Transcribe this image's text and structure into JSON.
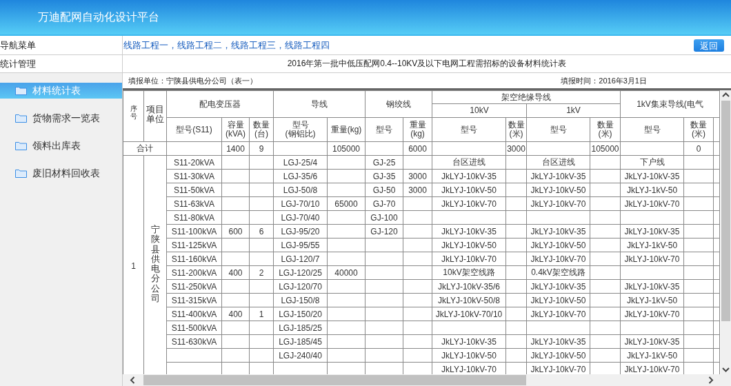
{
  "header": {
    "title": "万迪配网自动化设计平台"
  },
  "nav_bar": {
    "label": "导航菜单",
    "links": [
      "线路工程一",
      "线路工程二",
      "线路工程三",
      "线路工程四"
    ],
    "separator": "，",
    "back_button": "返回"
  },
  "section": {
    "label": "统计管理"
  },
  "sidebar": {
    "items": [
      {
        "label": "材料统计表",
        "selected": true
      },
      {
        "label": "货物需求一览表",
        "selected": false
      },
      {
        "label": "领料出库表",
        "selected": false
      },
      {
        "label": "废旧材料回收表",
        "selected": false
      }
    ]
  },
  "report": {
    "title": "2016年第一批中低压配网0.4--10KV及以下电网工程需招标的设备材料统计表",
    "unit": "填报单位：宁陕县供电分公司（表一）",
    "date": "填报时间：2016年3月1日"
  },
  "table": {
    "header_rows": [
      [
        {
          "label": "序号",
          "rowspan": 3,
          "kind": "stacked"
        },
        {
          "label": "项目单位",
          "rowspan": 3,
          "kind": "wrapped"
        },
        {
          "label": "配电变压器",
          "colspan": 3,
          "rowspan": 2
        },
        {
          "label": "导线",
          "colspan": 2,
          "rowspan": 2
        },
        {
          "label": "钢绞线",
          "colspan": 2,
          "rowspan": 2
        },
        {
          "label": "架空绝缘导线",
          "colspan": 4
        },
        {
          "label": "1kV集束导线(电气",
          "colspan": 3,
          "rowspan": 2
        }
      ],
      [
        {
          "label": "10kV",
          "colspan": 2
        },
        {
          "label": "1kV",
          "colspan": 2
        }
      ],
      [
        {
          "label": "型号(S11)"
        },
        {
          "label": "容量\n(kVA)"
        },
        {
          "label": "数量\n(台)"
        },
        {
          "label": "型号\n(钢铝比)"
        },
        {
          "label": "重量(kg)"
        },
        {
          "label": "型号"
        },
        {
          "label": "重量\n(kg)"
        },
        {
          "label": "型号"
        },
        {
          "label": "数量\n(米)"
        },
        {
          "label": "型号"
        },
        {
          "label": "数量\n(米)"
        },
        {
          "label": "型号"
        },
        {
          "label": "数量\n(米)"
        },
        {
          "kind": "blank"
        }
      ]
    ],
    "total_row": {
      "label": "合计",
      "capacity": "1400",
      "quantity": "9",
      "conductor_weight": "105000",
      "strand_weight": "6000",
      "kv10_length": "3000",
      "kv1_length": "105000",
      "bundled_length": "0"
    },
    "group": {
      "index": "1",
      "unit": "宁陕县供电分公司"
    },
    "rows": [
      {
        "transformer_model": "S11-20kVA",
        "conductor_model": "LGJ-25/4",
        "strand_model": "GJ-25",
        "kv10_model": "台区进线",
        "kv1_model": "台区进线",
        "bundled_model": "下户线"
      },
      {
        "transformer_model": "S11-30kVA",
        "conductor_model": "LGJ-35/6",
        "strand_model": "GJ-35",
        "strand_weight": "3000",
        "kv10_model": "JkLYJ-10kV-35",
        "kv1_model": "JkLYJ-10kV-35",
        "bundled_model": "JkLYJ-10kV-35"
      },
      {
        "transformer_model": "S11-50kVA",
        "conductor_model": "LGJ-50/8",
        "strand_model": "GJ-50",
        "strand_weight": "3000",
        "kv10_model": "JkLYJ-10kV-50",
        "kv1_model": "JkLYJ-10kV-50",
        "bundled_model": "JkLYJ-1kV-50"
      },
      {
        "transformer_model": "S11-63kVA",
        "conductor_model": "LGJ-70/10",
        "conductor_weight": "65000",
        "strand_model": "GJ-70",
        "kv10_model": "JkLYJ-10kV-70",
        "kv1_model": "JkLYJ-10kV-70",
        "bundled_model": "JkLYJ-10kV-70"
      },
      {
        "transformer_model": "S11-80kVA",
        "conductor_model": "LGJ-70/40",
        "strand_model": "GJ-100"
      },
      {
        "transformer_model": "S11-100kVA",
        "capacity": "600",
        "quantity": "6",
        "conductor_model": "LGJ-95/20",
        "strand_model": "GJ-120",
        "kv10_model": "JkLYJ-10kV-35",
        "kv1_model": "JkLYJ-10kV-35",
        "bundled_model": "JkLYJ-10kV-35"
      },
      {
        "transformer_model": "S11-125kVA",
        "conductor_model": "LGJ-95/55",
        "kv10_model": "JkLYJ-10kV-50",
        "kv1_model": "JkLYJ-10kV-50",
        "bundled_model": "JkLYJ-1kV-50"
      },
      {
        "transformer_model": "S11-160kVA",
        "conductor_model": "LGJ-120/7",
        "kv10_model": "JkLYJ-10kV-70",
        "kv1_model": "JkLYJ-10kV-70",
        "bundled_model": "JkLYJ-10kV-70"
      },
      {
        "transformer_model": "S11-200kVA",
        "capacity": "400",
        "quantity": "2",
        "conductor_model": "LGJ-120/25",
        "conductor_weight": "40000",
        "kv10_model": "10kV架空线路",
        "kv1_model": "0.4kV架空线路"
      },
      {
        "transformer_model": "S11-250kVA",
        "conductor_model": "LGJ-120/70",
        "kv10_model": "JkLYJ-10kV-35/6",
        "kv1_model": "JkLYJ-10kV-35",
        "bundled_model": "JkLYJ-10kV-35"
      },
      {
        "transformer_model": "S11-315kVA",
        "conductor_model": "LGJ-150/8",
        "kv10_model": "JkLYJ-10kV-50/8",
        "kv1_model": "JkLYJ-10kV-50",
        "bundled_model": "JkLYJ-1kV-50"
      },
      {
        "transformer_model": "S11-400kVA",
        "capacity": "400",
        "quantity": "1",
        "conductor_model": "LGJ-150/20",
        "kv10_model": "JkLYJ-10kV-70/10",
        "kv1_model": "JkLYJ-10kV-70",
        "bundled_model": "JkLYJ-10kV-70"
      },
      {
        "transformer_model": "S11-500kVA",
        "conductor_model": "LGJ-185/25"
      },
      {
        "transformer_model": "S11-630kVA",
        "conductor_model": "LGJ-185/45",
        "kv10_model": "JkLYJ-10kV-35",
        "kv1_model": "JkLYJ-10kV-35",
        "bundled_model": "JkLYJ-10kV-35"
      },
      {
        "conductor_model": "LGJ-240/40",
        "kv10_model": "JkLYJ-10kV-50",
        "kv1_model": "JkLYJ-10kV-50",
        "bundled_model": "JkLYJ-1kV-50"
      },
      {
        "kv10_model": "JkLYJ-10kV-70",
        "kv1_model": "JkLYJ-10kV-70",
        "bundled_model": "JkLYJ-10kV-70"
      }
    ]
  }
}
